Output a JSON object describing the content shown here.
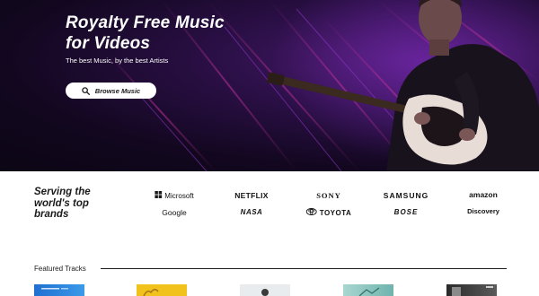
{
  "hero": {
    "title_line1": "Royalty Free Music",
    "title_line2": "for Videos",
    "subtitle": "The best Music, by the best Artists",
    "browse_label": "Browse Music"
  },
  "brands": {
    "heading_line1": "Serving the",
    "heading_line2": "world's top",
    "heading_line3": "brands",
    "logos": [
      "Microsoft",
      "NETFLIX",
      "SONY",
      "SAMSUNG",
      "amazon",
      "Google",
      "NASA",
      "TOYOTA",
      "BOSE",
      "Discovery"
    ]
  },
  "featured": {
    "title": "Featured Tracks"
  },
  "colors": {
    "hero_bg": "#12071f",
    "accent_purple": "#8a2fc4",
    "accent_magenta": "#c0309a",
    "text_dark": "#1b1b1b"
  },
  "icons": {
    "search": "search-icon",
    "microsoft": "microsoft-logo-icon",
    "toyota": "toyota-logo-icon"
  }
}
